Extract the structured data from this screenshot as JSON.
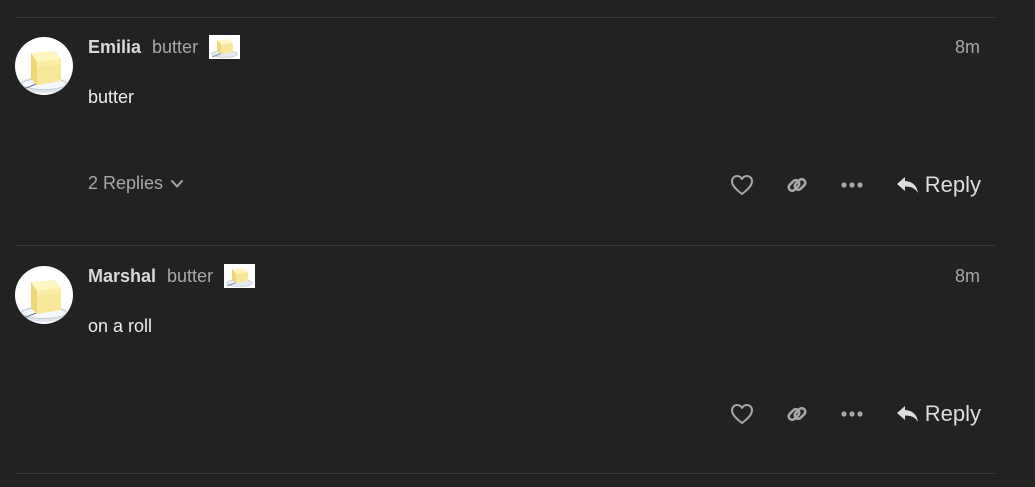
{
  "posts": [
    {
      "username": "Emilia",
      "user_title": "butter",
      "date": "8m",
      "body": "butter",
      "replies_label": "2 Replies",
      "reply_label": "Reply"
    },
    {
      "username": "Marshal",
      "user_title": "butter",
      "date": "8m",
      "body": "on a roll",
      "replies_label": "",
      "reply_label": "Reply"
    }
  ],
  "icons": {
    "avatar": "butter-image",
    "flair": "butter-image",
    "replies_toggle": "chevron-down-icon",
    "like": "heart-icon",
    "copy_link": "link-icon",
    "more": "ellipsis-icon",
    "reply": "reply-arrow-icon"
  },
  "colors": {
    "background": "#222222",
    "divider": "#3a3a3a",
    "primary_text": "#dddddd",
    "muted_text": "#a8a8a8",
    "icon": "#a8a8a8"
  }
}
